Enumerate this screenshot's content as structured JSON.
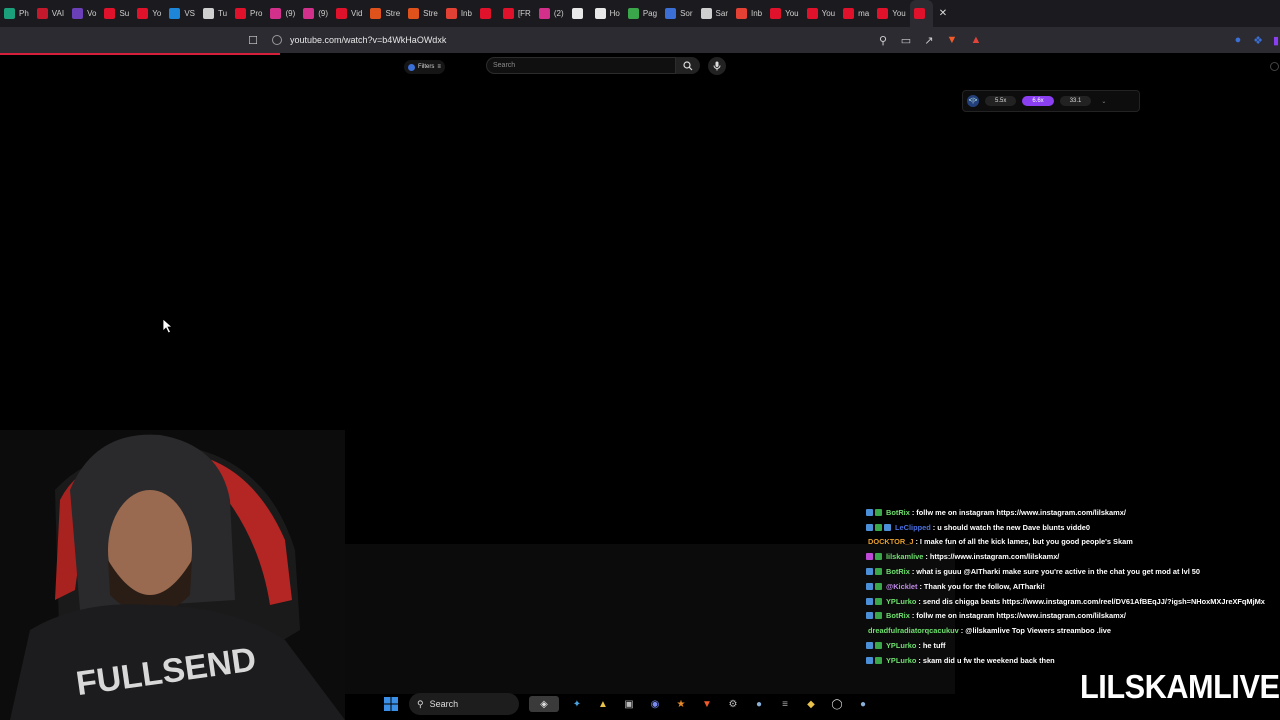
{
  "browser": {
    "tabs": [
      {
        "label": "Ph",
        "color": "#1aa07b"
      },
      {
        "label": "VAI",
        "color": "#c4182c"
      },
      {
        "label": "Vo",
        "color": "#6b3fb8"
      },
      {
        "label": "Su",
        "color": "#e0112b"
      },
      {
        "label": "Yo",
        "color": "#e0112b"
      },
      {
        "label": "VS",
        "color": "#1d86d8"
      },
      {
        "label": "Tu",
        "color": "#cfcfcf"
      },
      {
        "label": "Pro",
        "color": "#e0112b"
      },
      {
        "label": "(9)",
        "color": "#d3308c"
      },
      {
        "label": "(9)",
        "color": "#d3308c"
      },
      {
        "label": "Vid",
        "color": "#e0112b"
      },
      {
        "label": "Stre",
        "color": "#e0521b"
      },
      {
        "label": "Stre",
        "color": "#e0521b"
      },
      {
        "label": "Inb",
        "color": "#e34133"
      },
      {
        "label": "",
        "color": "#e0112b"
      },
      {
        "label": "[FR",
        "color": "#e0112b"
      },
      {
        "label": "(2)",
        "color": "#d3308c"
      },
      {
        "label": "",
        "color": "#e8e8e8"
      },
      {
        "label": "Ho",
        "color": "#e8e8e8"
      },
      {
        "label": "Pag",
        "color": "#3aa74a"
      },
      {
        "label": "Sor",
        "color": "#3b6fd6"
      },
      {
        "label": "Sar",
        "color": "#cfcfcf"
      },
      {
        "label": "Inb",
        "color": "#e34133"
      },
      {
        "label": "You",
        "color": "#e0112b"
      },
      {
        "label": "You",
        "color": "#e0112b"
      },
      {
        "label": "ma",
        "color": "#e0112b"
      },
      {
        "label": "You",
        "color": "#e0112b"
      },
      {
        "label": "",
        "color": "#e0112b"
      }
    ],
    "url": "youtube.com/watch?v=b4WkHaOWdxk"
  },
  "youtube": {
    "filters_label": "Filters",
    "search_placeholder": "Search"
  },
  "speed_widget": {
    "logo": "<|>",
    "options": [
      {
        "label": "5.5x",
        "active": false
      },
      {
        "label": "6.6x",
        "active": true
      },
      {
        "label": "33.1",
        "active": false
      }
    ]
  },
  "chat": [
    {
      "user": "BotRix",
      "color": "#6fe06f",
      "badges": [
        "#4a8fd8",
        "#3aa74a"
      ],
      "text": "follw me on instagram https://www.instagram.com/lilskamx/"
    },
    {
      "user": "LeClipped",
      "color": "#4a6fe0",
      "badges": [
        "#4a8fd8",
        "#3aa74a",
        "#4a8fd8"
      ],
      "text": "u should watch the new Dave blunts vidde0"
    },
    {
      "user": "DOCKTOR_J",
      "color": "#e8a030",
      "badges": [],
      "text": "I make fun of all the kick lames, but you good people's Skam"
    },
    {
      "user": "lilskamlive",
      "color": "#6fe06f",
      "badges": [
        "#c04ad8",
        "#3aa74a"
      ],
      "text": "https://www.instagram.com/lilskamx/"
    },
    {
      "user": "BotRix",
      "color": "#6fe06f",
      "badges": [
        "#4a8fd8",
        "#3aa74a"
      ],
      "text": "what is guuu @AITharki make sure you're active in the chat you get mod at lvl 50"
    },
    {
      "user": "@Kicklet",
      "color": "#c08ae8",
      "badges": [
        "#4a8fd8",
        "#3aa74a"
      ],
      "text": "Thank you for the follow, AITharki!"
    },
    {
      "user": "YPLurko",
      "color": "#6fe06f",
      "badges": [
        "#4a8fd8",
        "#3aa74a"
      ],
      "text": "send dis chigga beats https://www.instagram.com/reel/DV61AfBEqJJ/?igsh=NHoxMXJreXFqMjMx"
    },
    {
      "user": "BotRix",
      "color": "#6fe06f",
      "badges": [
        "#4a8fd8",
        "#3aa74a"
      ],
      "text": "follw me on instagram https://www.instagram.com/lilskamx/"
    },
    {
      "user": "dreadfulradiatorqcacukuv",
      "color": "#6fe06f",
      "badges": [],
      "text": "@lilskamlive Top Viewers streamboo .live"
    },
    {
      "user": "YPLurko",
      "color": "#6fe06f",
      "badges": [
        "#4a8fd8",
        "#3aa74a"
      ],
      "text": "he tuff"
    },
    {
      "user": "YPLurko",
      "color": "#6fe06f",
      "badges": [
        "#4a8fd8",
        "#3aa74a"
      ],
      "text": "skam did u fw the weekend back then"
    }
  ],
  "taskbar": {
    "search_label": "Search"
  },
  "overlay": {
    "streamer_name": "LILSKAMLIVE"
  },
  "icons": {
    "bookmark": "bookmark-icon",
    "site_info": "site-info-icon",
    "zoom": "zoom-icon",
    "cast": "cast-icon",
    "share": "share-icon",
    "brave": "brave-shield-icon",
    "search": "search-icon",
    "mic": "microphone-icon",
    "windows": "windows-start-icon"
  }
}
